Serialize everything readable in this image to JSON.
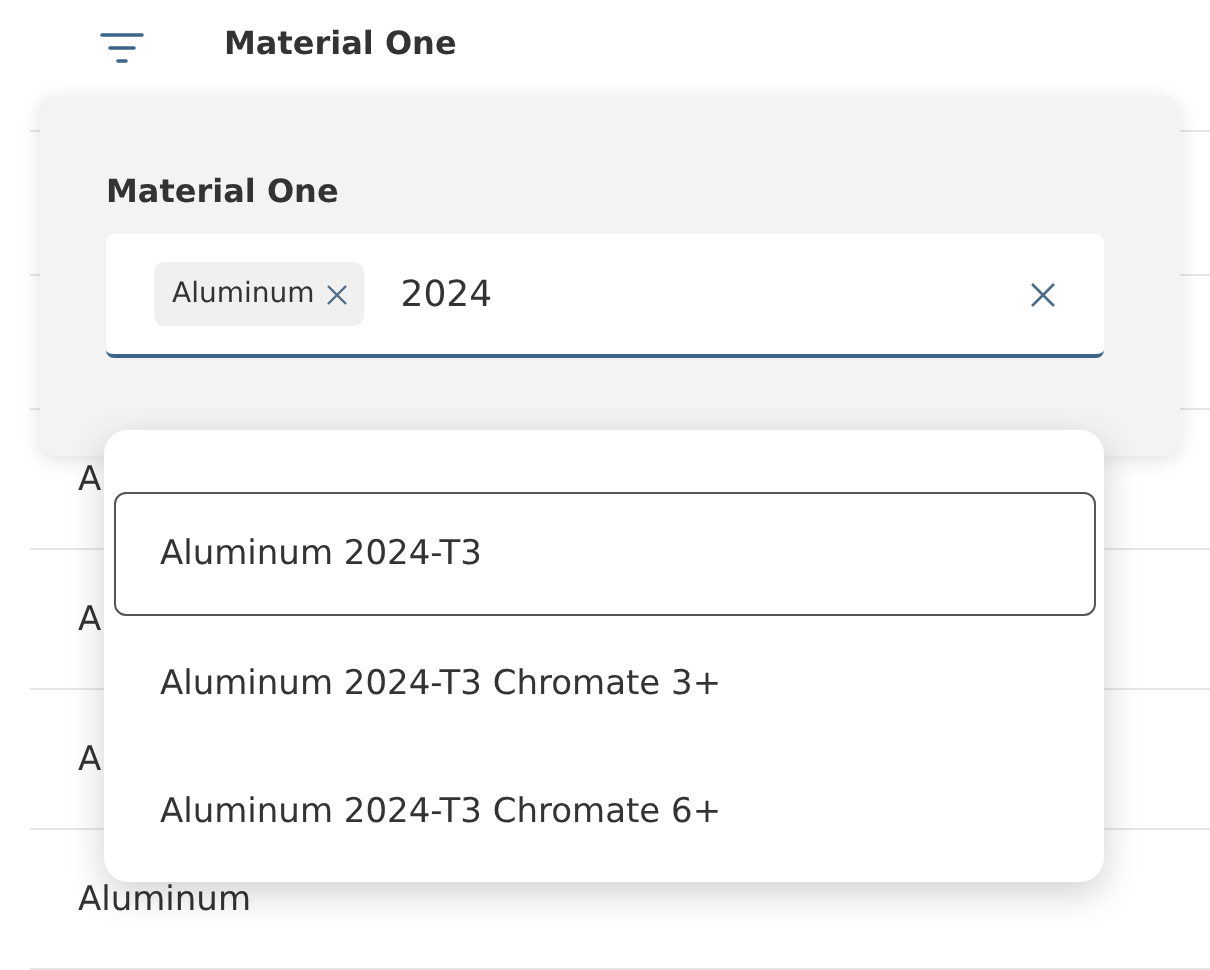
{
  "header": {
    "title": "Material One"
  },
  "rows": [
    "A",
    "A",
    "A",
    "Aluminum"
  ],
  "filter_panel": {
    "label": "Material One",
    "chips": [
      {
        "label": "Aluminum"
      }
    ],
    "value": "2024"
  },
  "options": [
    {
      "label": "Aluminum 2024-T3",
      "selected": true
    },
    {
      "label": "Aluminum 2024-T3 Chromate 3+",
      "selected": false
    },
    {
      "label": "Aluminum 2024-T3 Chromate 6+",
      "selected": false
    }
  ]
}
